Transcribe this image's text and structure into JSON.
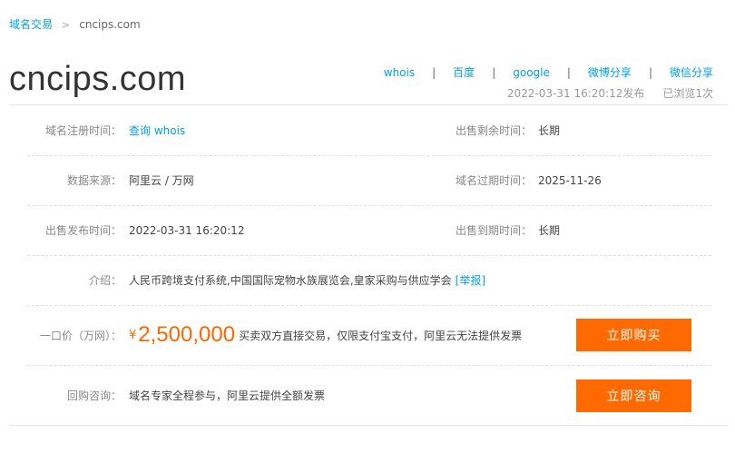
{
  "breadcrumb": {
    "parent": "域名交易",
    "separator": ">",
    "current": "cncips.com"
  },
  "domain": "cncips.com",
  "share_links": [
    "whois",
    "百度",
    "google",
    "微博分享",
    "微信分享"
  ],
  "share_separator": "|",
  "meta": {
    "published": "2022-03-31 16:20:12发布",
    "views": "已浏览1次"
  },
  "fields": {
    "reg_time": {
      "label": "域名注册时间：",
      "value": "查询 whois"
    },
    "remaining": {
      "label": "出售剩余时间：",
      "value": "长期"
    },
    "source": {
      "label": "数据来源：",
      "value": "阿里云 / 万网"
    },
    "expire": {
      "label": "域名过期时间：",
      "value": "2025-11-26"
    },
    "publish": {
      "label": "出售发布时间：",
      "value": "2022-03-31 16:20:12"
    },
    "sale_end": {
      "label": "出售到期时间：",
      "value": "长期"
    },
    "intro": {
      "label": "介绍：",
      "value": "人民币跨境支付系统,中国国际宠物水族展览会,皇家采购与供应学会",
      "report": "[举报]"
    }
  },
  "price": {
    "label": "一口价（万网）：",
    "currency": "¥",
    "amount": "2,500,000",
    "note": "买卖双方直接交易，仅限支付宝支付，阿里云无法提供发票",
    "button": "立即购买"
  },
  "buyback": {
    "label": "回购咨询：",
    "note": "域名专家全程参与，阿里云提供全额发票",
    "button": "立即咨询"
  },
  "colors": {
    "accent": "#00a0e9",
    "price": "#ff6600",
    "button": "#ff6a00"
  }
}
